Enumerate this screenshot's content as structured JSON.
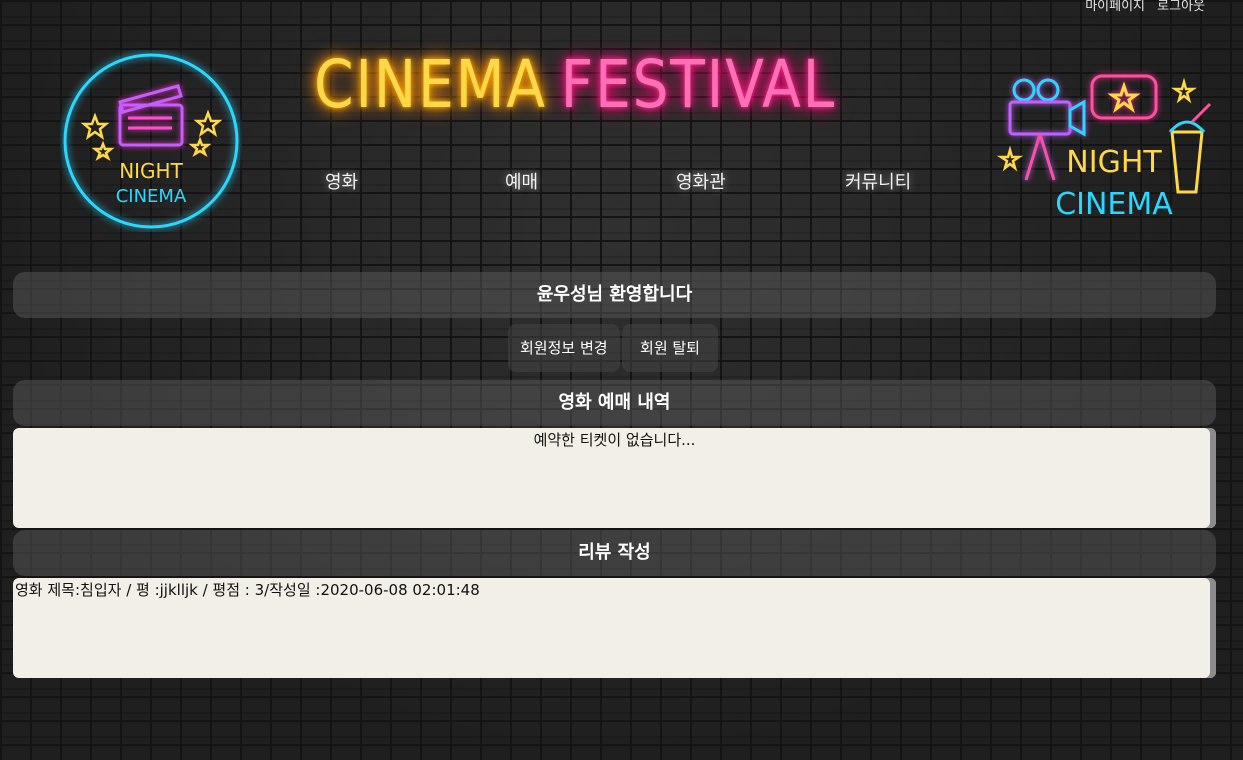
{
  "topnav": {
    "mypage": "마이페이지",
    "logout": "로그아웃"
  },
  "logo_left": {
    "line1": "NIGHT",
    "line2": "CINEMA"
  },
  "logo_right": {
    "line1": "NIGHT",
    "line2": "CINEMA"
  },
  "title": {
    "part1": "CINEMA",
    "part2": "FESTIVAL"
  },
  "menu": [
    "영화",
    "예매",
    "영화관",
    "커뮤니티"
  ],
  "welcome": "윤우성님 환영합니다",
  "buttons": {
    "edit": "회원정보 변경",
    "withdraw": "회원 탈퇴"
  },
  "reservation": {
    "title": "영화 예매 내역",
    "empty": "예약한 티켓이 없습니다..."
  },
  "review": {
    "title": "리뷰 작성",
    "entry": "영화 제목:침입자 / 평 :jjklljk / 평점 : 3/작성일 :2020-06-08 02:01:48"
  },
  "colors": {
    "neon_yellow": "#ffd84a",
    "neon_pink": "#ff6fb5",
    "neon_cyan": "#2ad8ff",
    "panel": "#f2f0e6"
  }
}
